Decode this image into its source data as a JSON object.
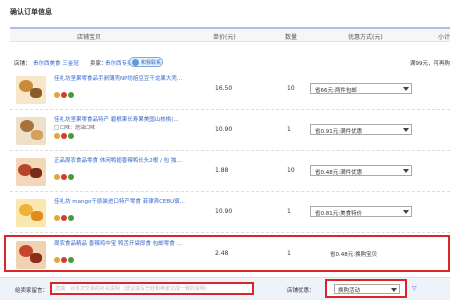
{
  "page": {
    "title": "确认订单信息"
  },
  "header": {
    "columns": [
      "店铺宝贝",
      "单价(元)",
      "数量",
      "优惠方式(元)",
      "小计"
    ]
  },
  "shop": {
    "shop_label": "店铺：",
    "shop_name": "贵尔西美食 三金冠",
    "seller_label": "卖家：",
    "seller_name": "贵尔西专卖",
    "ww_label": "和我联系",
    "remaining": "满99元，可再购"
  },
  "items": [
    {
      "name": "佳礼坊坚果零食品手剥薄壳NP坊焙豆豆干龙果大壳...",
      "sub": "",
      "price": "16.50",
      "qty": "10",
      "promo": "省66元:两件包邮",
      "has_select": true
    },
    {
      "name": "佳礼坊坚果零食品特产 碧根果长寿果美国山核桃(...",
      "sub": "口味：焙油口味",
      "price": "10.90",
      "qty": "1",
      "promo": "省0.91元:满件优惠",
      "has_select": true
    },
    {
      "name": "正品周农食品零食 休闲鸭翅香辣鸭长头2根 / 包 独...",
      "sub": "",
      "price": "1.88",
      "qty": "10",
      "promo": "省0.48元:满件优惠",
      "has_select": true
    },
    {
      "name": "佳礼坊 mango干原装进口特产零食 菲律宾CEBU宿...",
      "sub": "",
      "price": "10.90",
      "qty": "1",
      "promo": "省0.81元:美食特价",
      "has_select": true
    },
    {
      "name": "周农食品精品 香辣鸡中宝 鸭舌开袋即食 包邮零食 ...",
      "sub": "",
      "price": "2.48",
      "qty": "1",
      "promo": "省0.48元:换购宝贝",
      "has_select": false
    }
  ],
  "footer": {
    "message_label": "给卖家留言：",
    "message_placeholder": "选填：对本次交易的补充说明（建议填写已经和卖家达成一致的说明）",
    "promo_label": "店铺优惠：",
    "promo_value": "换购活动",
    "fold": "▽"
  },
  "colors": {
    "accent": "#3366cc",
    "highlight": "#d8272a",
    "header_border": "#a9c2e6"
  }
}
